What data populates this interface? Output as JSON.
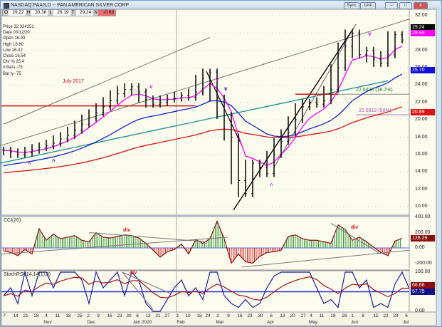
{
  "window": {
    "title": "NASDAQ:PAAS,D -- PAN AMERICAN SILVER CORP",
    "buttons": [
      "Sync",
      "Link",
      "–",
      "□",
      "✕"
    ]
  },
  "ohlc_strip": {
    "o_label": "O",
    "o": "29.22",
    "h_label": "H",
    "h": "30.38",
    "l_label": "L",
    "l": "29.19",
    "t_label": "T",
    "t": "29.24",
    "n_label": "N",
    "n": "-0.63"
  },
  "info_box": [
    "Price  32.324251",
    "Date  03/12/20",
    "Open  16.93",
    "High  16.60",
    "Low  16.02",
    "Close  16.54",
    "Chr %  25.4",
    "# Bars -75",
    "Bar ly  -75"
  ],
  "colors": {
    "bg": "#fbfbee",
    "price_bar": "#111111",
    "ma_short": "#ff00ff",
    "ma_mid": "#1020d0",
    "ma_long": "#e01010",
    "channel": "#777777",
    "teal": "#1a8f8f",
    "cci_pos": "#3c9a3c",
    "cci_neg": "#e03030"
  },
  "chart_data": [
    {
      "type": "ohlc",
      "title": "NASDAQ:PAAS,D",
      "ylim": [
        9,
        32.5
      ],
      "y_ticks": [
        "32.00",
        "30.00",
        "28.00",
        "26.00",
        "24.00",
        "22.00",
        "20.00",
        "18.00",
        "16.00",
        "14.00",
        "12.00",
        "10.00"
      ],
      "closes": [
        16.5,
        16.3,
        16.0,
        16.2,
        16.5,
        16.8,
        17.0,
        17.3,
        17.8,
        18.2,
        18.8,
        19.5,
        20.2,
        20.8,
        21.5,
        22.2,
        23.0,
        23.5,
        23.8,
        23.2,
        22.4,
        21.8,
        22.0,
        22.4,
        22.5,
        22.8,
        22.6,
        23.2,
        24.8,
        25.5,
        22.5,
        20.5,
        18.0,
        13.0,
        11.5,
        15.0,
        14.5,
        13.8,
        16.0,
        17.5,
        18.5,
        20.0,
        21.5,
        22.0,
        21.8,
        22.2,
        23.5,
        26.0,
        28.5,
        30.0,
        27.5,
        28.0,
        27.0,
        26.5,
        27.5,
        29.8,
        29.2
      ],
      "badges": [
        {
          "label": "29.24",
          "color": "#000000"
        },
        {
          "label": "28.69",
          "color": "#ff00ff"
        },
        {
          "label": "25.70",
          "color": "#1010e0"
        },
        {
          "label": "20.89",
          "color": "#e01010"
        }
      ],
      "annotations": {
        "july2017": "July 2017",
        "fib382": "22.9438 (38.2%)",
        "fib50": "20.5819 (50%)",
        "fib382_value": 22.9438,
        "fib50_value": 20.5819,
        "july2017_value": 21.6
      }
    },
    {
      "type": "bar",
      "title": "CCI(20)",
      "ylim": [
        -250,
        420
      ],
      "y_ticks": [
        "400.00",
        "200.00",
        "0.00",
        "-200.00"
      ],
      "last": "126.29",
      "div_label": "div",
      "values": [
        -40,
        -60,
        -100,
        -20,
        -80,
        250,
        100,
        180,
        120,
        140,
        160,
        100,
        80,
        200,
        140,
        130,
        150,
        170,
        160,
        130,
        60,
        -30,
        -120,
        -50,
        -20,
        50,
        -80,
        110,
        60,
        120,
        350,
        120,
        -200,
        -80,
        -180,
        -200,
        -110,
        -60,
        -50,
        -30,
        150,
        170,
        120,
        100,
        100,
        80,
        60,
        300,
        240,
        100,
        140,
        80,
        10,
        -60,
        -100,
        90,
        126
      ]
    },
    {
      "type": "line",
      "title": "StochRSI(14,14(1),3)",
      "ylim": [
        0,
        100
      ],
      "y_ticks": [
        "100.00",
        "50.00",
        "0.00"
      ],
      "last_fast": "57.75",
      "last_slow": "66.66",
      "div_label": "div",
      "values": [
        40,
        60,
        20,
        100,
        40,
        100,
        100,
        60,
        100,
        100,
        100,
        80,
        20,
        100,
        60,
        80,
        100,
        40,
        100,
        80,
        20,
        0,
        0,
        30,
        60,
        80,
        40,
        60,
        30,
        100,
        100,
        40,
        20,
        10,
        30,
        10,
        20,
        60,
        90,
        100,
        100,
        100,
        100,
        100,
        60,
        20,
        30,
        10,
        100,
        100,
        60,
        80,
        10,
        20,
        10,
        70,
        100,
        58
      ]
    }
  ],
  "x_axis": {
    "days": [
      "7",
      "14",
      "21",
      "28",
      "4",
      "11",
      "18",
      "25",
      "2",
      "9",
      "16",
      "23",
      "30",
      "6",
      "13",
      "21",
      "27",
      "3",
      "10",
      "18",
      "24",
      "2",
      "9",
      "16",
      "23",
      "30",
      "6",
      "13",
      "20",
      "27",
      "4",
      "11",
      "18",
      "26",
      "1",
      "8",
      "15",
      "22",
      "29",
      "6"
    ],
    "months": [
      "Nov",
      "Dec",
      "Jan 2020",
      "Feb",
      "Mar",
      "Apr",
      "May",
      "Jun",
      "Jul"
    ]
  }
}
